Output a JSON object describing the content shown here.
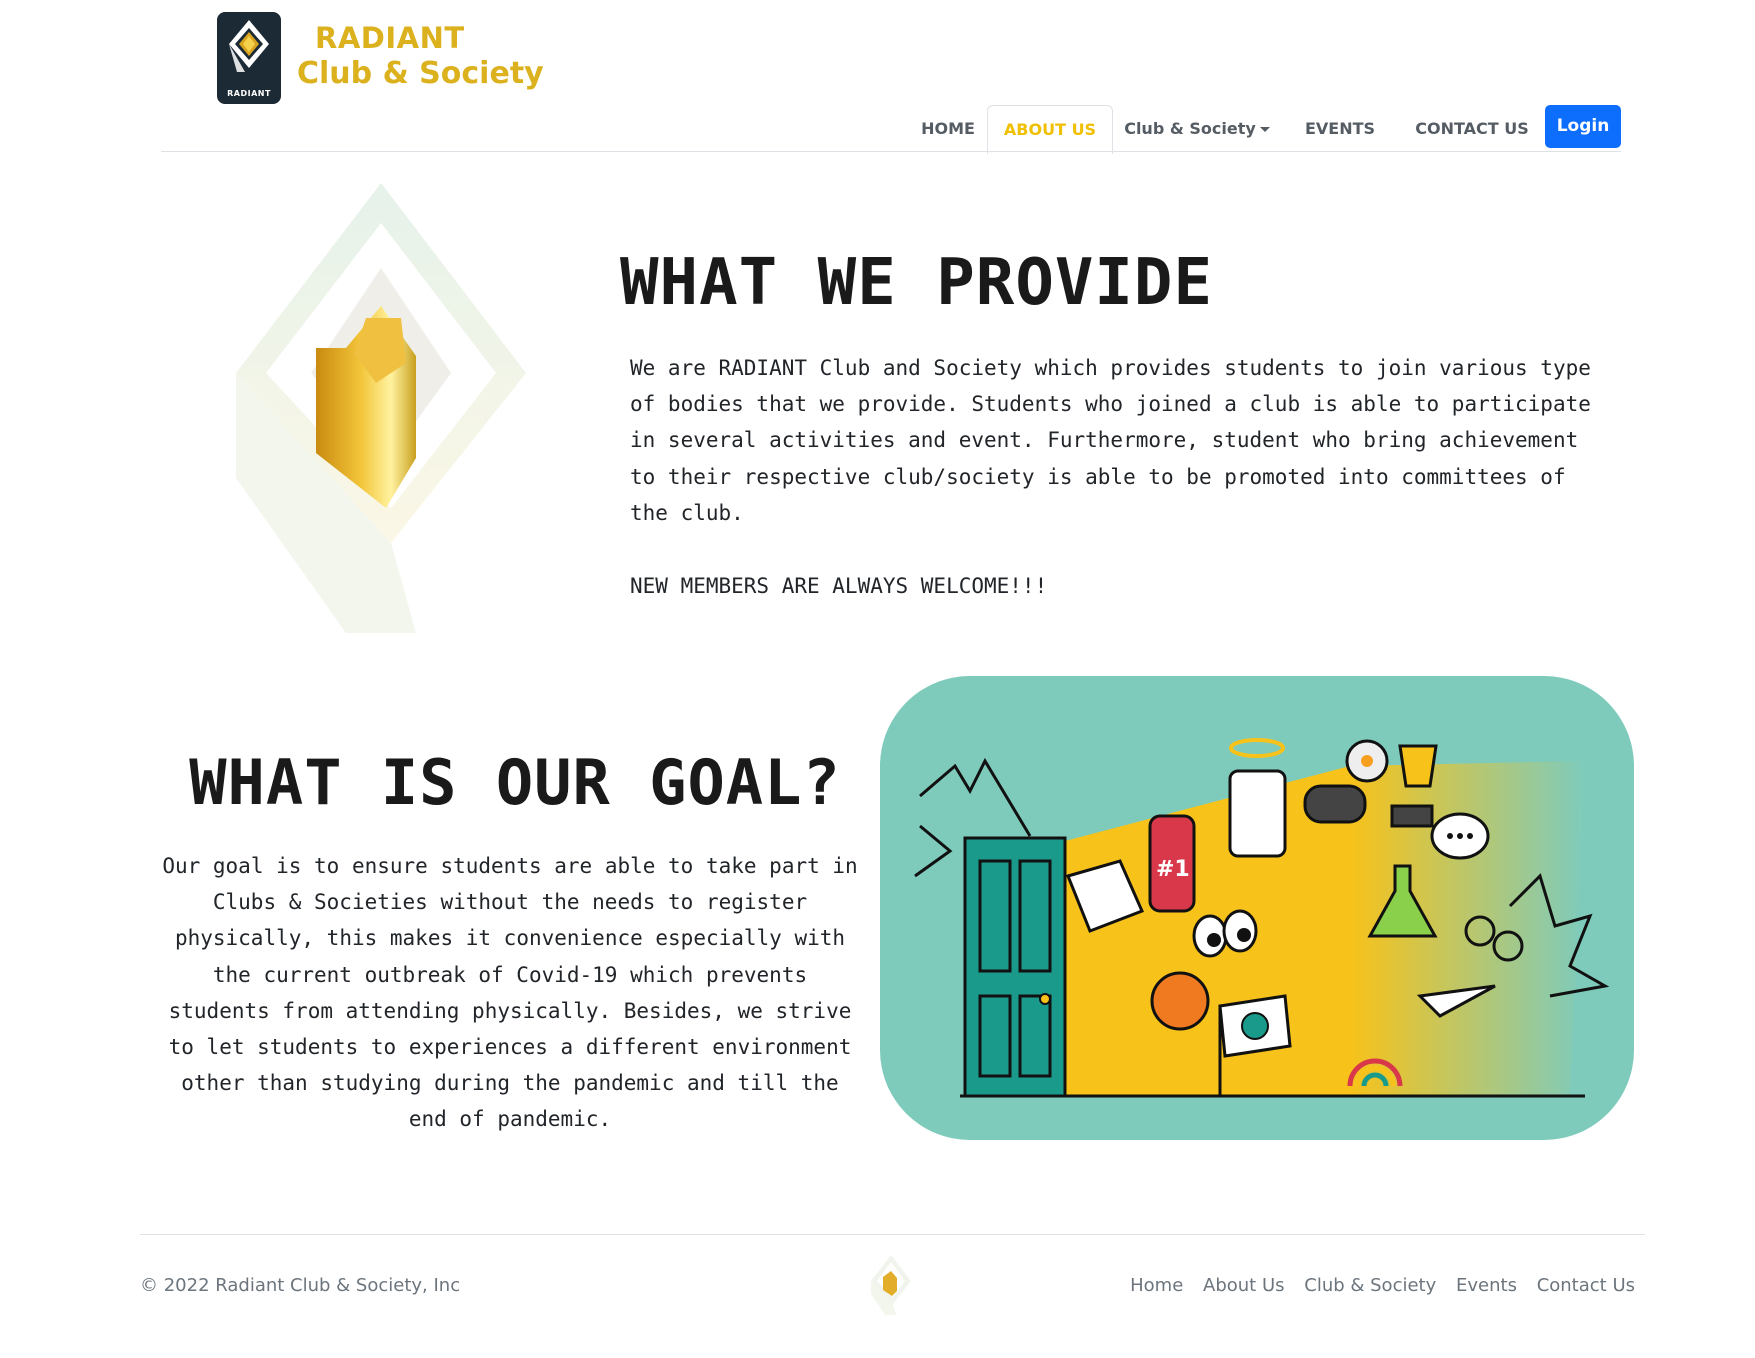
{
  "header": {
    "logo_label": "RADIANT",
    "brand_line1": "RADIANT",
    "brand_line2": "Club & Society"
  },
  "nav": {
    "home": "HOME",
    "about": "ABOUT US",
    "club": "Club & Society",
    "events": "EVENTS",
    "contact": "CONTACT US",
    "login": "Login"
  },
  "provide": {
    "title": "WHAT WE PROVIDE",
    "body": "We are RADIANT Club and Society which provides students to join various type of bodies that we provide. Students who joined a club is able to participate in several activities and event. Furthermore, student who bring achievement to their respective club/society is able to be promoted into committees of the club.",
    "welcome": "NEW MEMBERS ARE ALWAYS WELCOME!!!"
  },
  "goal": {
    "title": "WHAT IS OUR GOAL?",
    "body": "Our goal is to ensure students are able to take part in Clubs & Societies without the needs to register physically, this makes it convenience especially with the current outbreak of Covid-19 which prevents students from attending physically. Besides, we strive to let students to experiences a different environment other than studying during the pandemic and till the end of pandemic.",
    "illustration_badge": "#1"
  },
  "footer": {
    "copyright": "© 2022 Radiant Club & Society, Inc",
    "links": [
      "Home",
      "About Us",
      "Club & Society",
      "Events",
      "Contact Us"
    ]
  },
  "colors": {
    "brand_gold": "#dcb11e",
    "nav_active": "#f0c000",
    "login_blue": "#0d6efd",
    "illustration_bg": "#7ecbbc"
  }
}
